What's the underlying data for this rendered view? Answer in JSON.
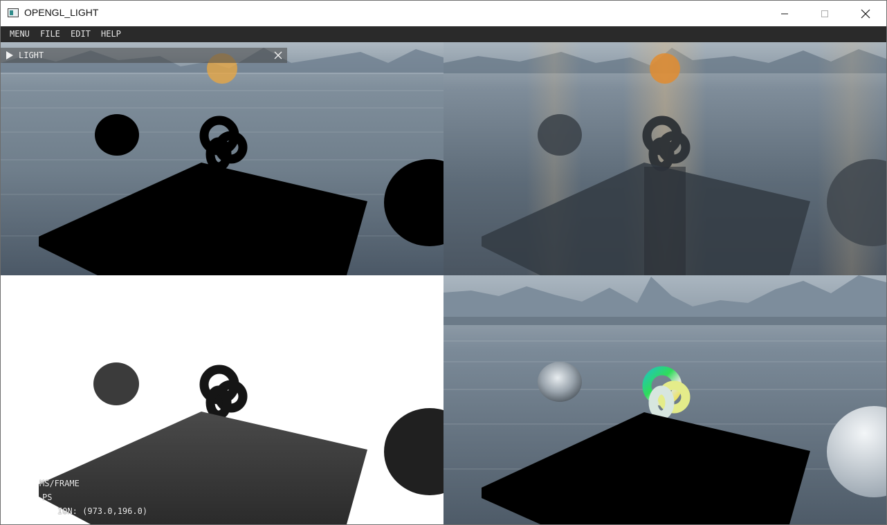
{
  "window": {
    "title": "OPENGL_LIGHT",
    "minimize_icon": "minimize-icon",
    "maximize_icon": "maximize-icon",
    "close_icon": "close-icon"
  },
  "menubar": {
    "items": [
      {
        "label": "MENU"
      },
      {
        "label": "FILE"
      },
      {
        "label": "EDIT"
      },
      {
        "label": "HELP"
      }
    ]
  },
  "light_panel": {
    "title": "LIGHT",
    "expand_icon": "triangle-right-icon",
    "close_icon": "close-icon"
  },
  "stats": {
    "line1": "MS/FRAME",
    "line2": "PS",
    "line3": "ION: (973.0,196.0)"
  },
  "colors": {
    "menubar_bg": "#2a2a2a",
    "panel_bg": "rgba(70,70,70,0.55)",
    "sun": "#e6a645"
  }
}
